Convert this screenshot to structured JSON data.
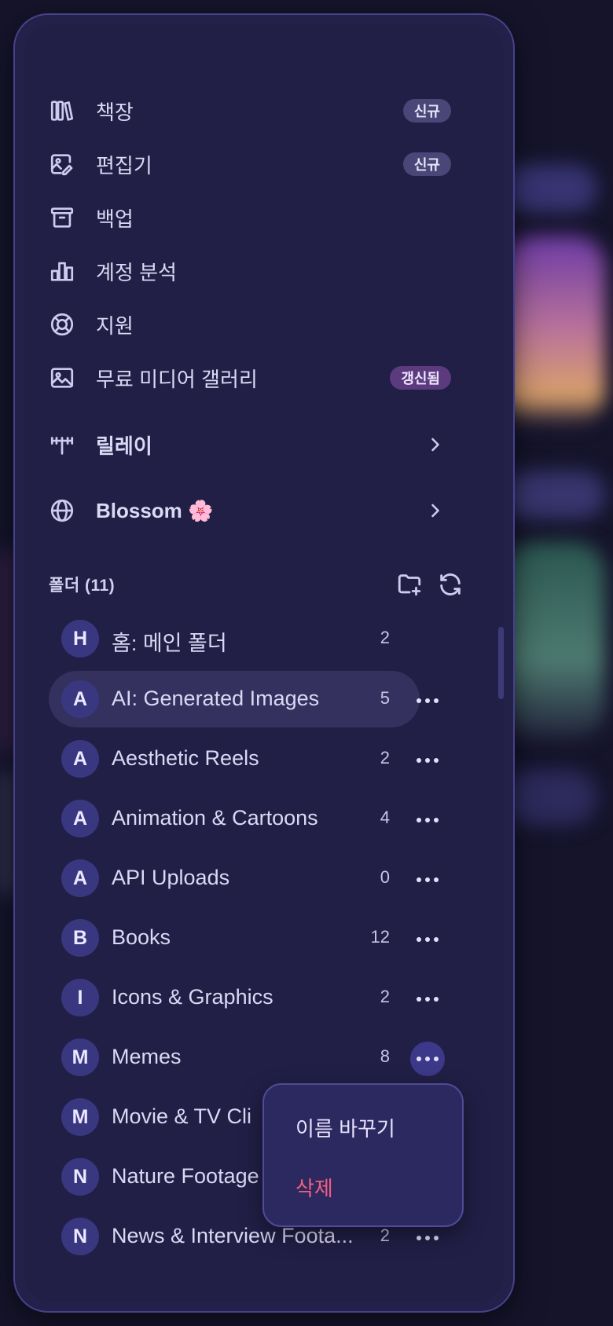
{
  "menu": {
    "items": [
      {
        "label": "책장",
        "badge": "신규",
        "icon": "books-icon"
      },
      {
        "label": "편집기",
        "badge": "신규",
        "icon": "image-edit-icon"
      },
      {
        "label": "백업",
        "icon": "archive-icon"
      },
      {
        "label": "계정 분석",
        "icon": "bar-chart-icon"
      },
      {
        "label": "지원",
        "icon": "lifebuoy-icon"
      },
      {
        "label": "무료 미디어 갤러리",
        "badge": "갱신됨",
        "icon": "image-icon"
      }
    ],
    "submenus": [
      {
        "label": "릴레이",
        "icon": "antenna-icon"
      },
      {
        "label": "Blossom 🌸",
        "icon": "globe-icon"
      }
    ]
  },
  "folders": {
    "title": "폴더 (11)",
    "items": [
      {
        "initial": "H",
        "name": "홈: 메인 폴더",
        "count": "2"
      },
      {
        "initial": "A",
        "name": "AI: Generated Images",
        "count": "5"
      },
      {
        "initial": "A",
        "name": "Aesthetic Reels",
        "count": "2"
      },
      {
        "initial": "A",
        "name": "Animation & Cartoons",
        "count": "4"
      },
      {
        "initial": "A",
        "name": "API Uploads",
        "count": "0"
      },
      {
        "initial": "B",
        "name": "Books",
        "count": "12"
      },
      {
        "initial": "I",
        "name": "Icons & Graphics",
        "count": "2"
      },
      {
        "initial": "M",
        "name": "Memes",
        "count": "8"
      },
      {
        "initial": "M",
        "name": "Movie & TV Cli",
        "count": ""
      },
      {
        "initial": "N",
        "name": "Nature Footage",
        "count": ""
      },
      {
        "initial": "N",
        "name": "News & Interview Foota...",
        "count": "2"
      }
    ]
  },
  "context_menu": {
    "rename": "이름 바꾸기",
    "delete": "삭제"
  },
  "colors": {
    "panel": "#23204a",
    "accent": "#3a3781",
    "danger": "#f0607e"
  }
}
